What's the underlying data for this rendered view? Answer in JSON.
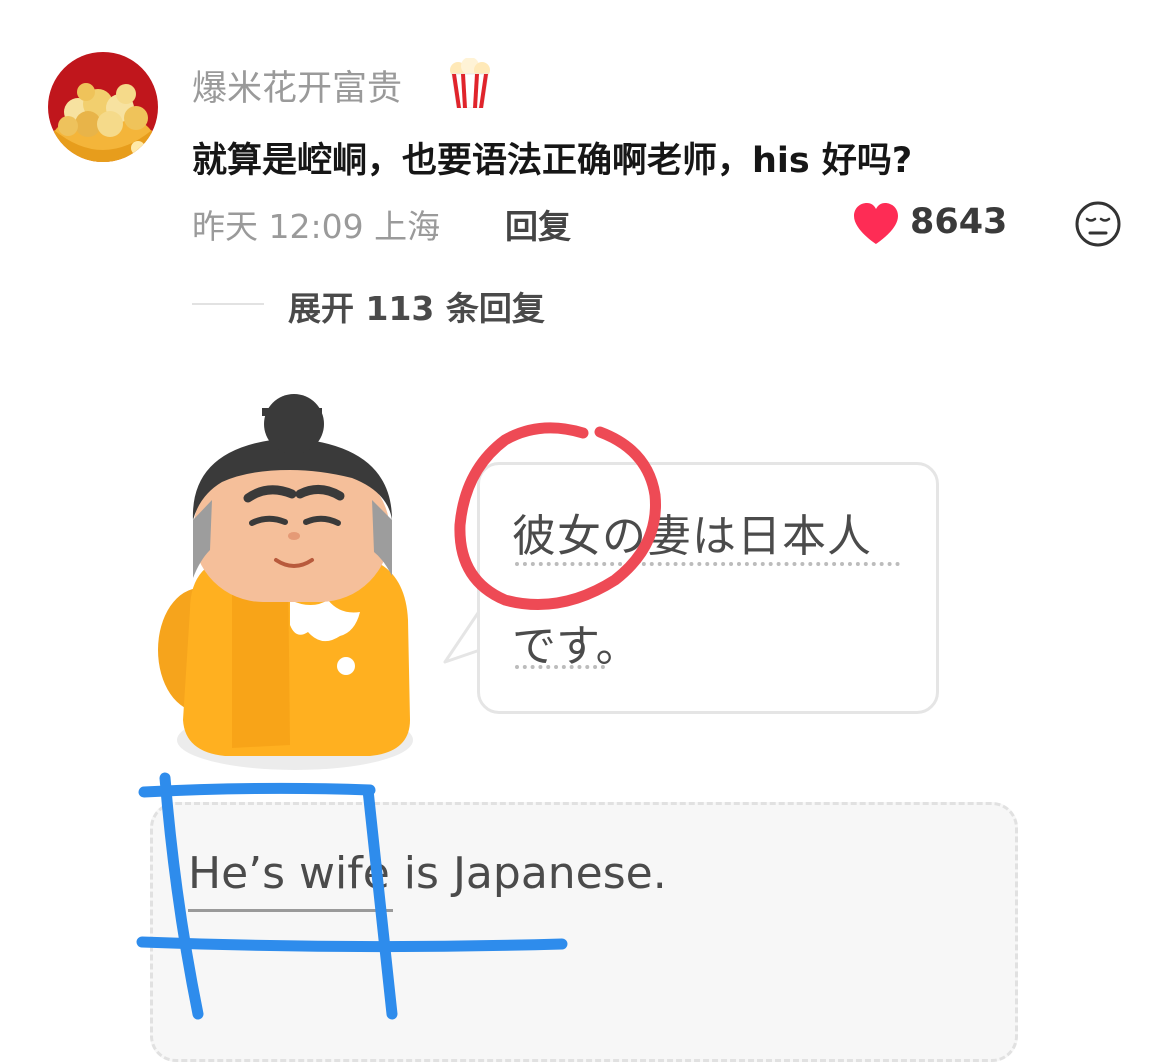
{
  "comment": {
    "username": "爆米花开富贵",
    "username_emoji": "popcorn-icon",
    "text": "就算是崆峒，也要语法正确啊老师，his 好吗?",
    "time_location": "昨天 12:09 上海",
    "reply_label": "回复",
    "like_count": "8643",
    "like_icon": "heart-icon",
    "like_color": "#fe2c55",
    "dislike_icon": "unamused-face-icon",
    "expand_replies_label": "展开 113 条回复"
  },
  "lesson": {
    "bubble_line1": "彼女の妻は日本人",
    "bubble_line2": "です。",
    "answer_text": "He’s wife  is Japanese.",
    "annotation_red": "#ee4a55",
    "annotation_blue": "#2e8cec"
  }
}
